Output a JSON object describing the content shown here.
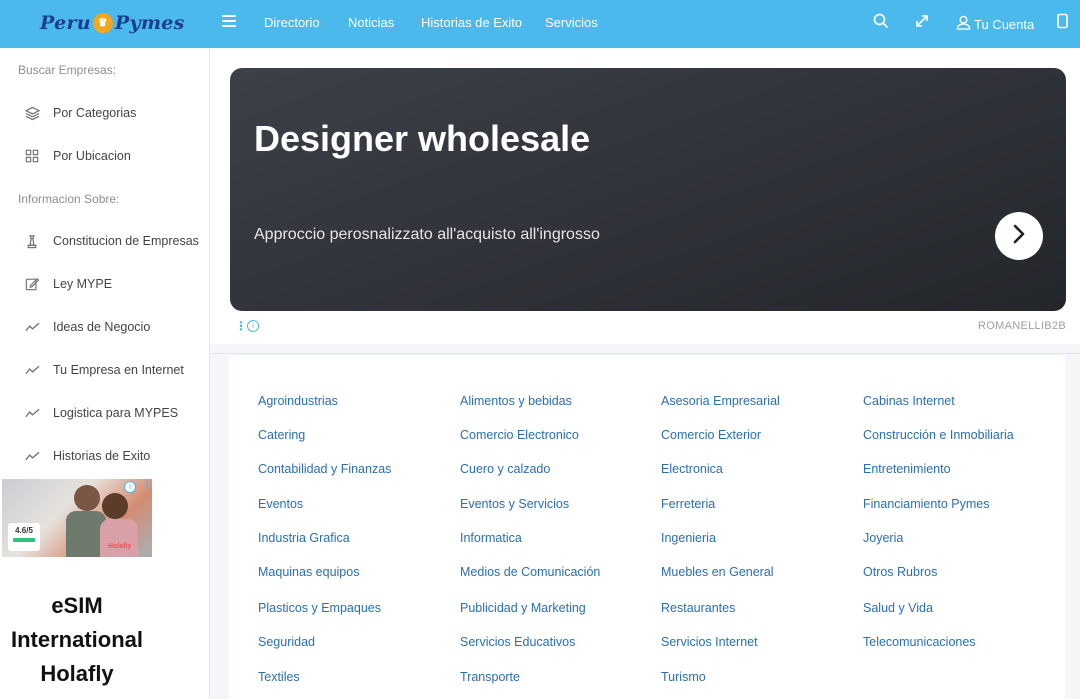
{
  "header": {
    "logo_left": "Peru",
    "logo_right": "Pymes",
    "nav": [
      "Directorio",
      "Noticias",
      "Historias de Exito",
      "Servicios"
    ],
    "account_label": "Tu Cuenta",
    "icons": [
      "menu-icon",
      "search-icon",
      "expand-icon",
      "user-icon",
      "panel-icon"
    ]
  },
  "sidebar": {
    "heading_search": "Buscar Empresas:",
    "search_items": [
      {
        "label": "Por Categorias",
        "icon": "layers-icon"
      },
      {
        "label": "Por Ubicacion",
        "icon": "grid-icon"
      }
    ],
    "heading_info": "Informacion Sobre:",
    "info_items": [
      {
        "label": "Constitucion de Empresas",
        "icon": "chess-icon"
      },
      {
        "label": "Ley MYPE",
        "icon": "edit-icon"
      },
      {
        "label": "Ideas de Negocio",
        "icon": "trend-icon"
      },
      {
        "label": "Tu Empresa en Internet",
        "icon": "trend-icon"
      },
      {
        "label": "Logistica para MYPES",
        "icon": "trend-icon"
      },
      {
        "label": "Historias de Exito",
        "icon": "trend-icon"
      }
    ]
  },
  "side_ad": {
    "rating": "4.6/5",
    "brand_tag": "Holafly",
    "title_lines": [
      "eSIM",
      "International",
      "Holafly"
    ]
  },
  "banner_ad": {
    "title": "Designer wholesale",
    "subtitle": "Approccio perosnalizzato all'acquisto all'ingrosso",
    "advertiser": "ROMANELLIB2B"
  },
  "categories": [
    [
      "Agroindustrias",
      "Alimentos y bebidas",
      "Asesoria Empresarial",
      "Cabinas Internet"
    ],
    [
      "Catering",
      "Comercio Electronico",
      "Comercio Exterior",
      "Construcción e Inmobiliaria"
    ],
    [
      "Contabilidad y Finanzas",
      "Cuero y calzado",
      "Electronica",
      "Entretenimiento"
    ],
    [
      "Eventos",
      "Eventos y Servicios",
      "Ferreteria",
      "Financiamiento Pymes"
    ],
    [
      "Industria Grafica",
      "Informatica",
      "Ingenieria",
      "Joyeria"
    ],
    [
      "Maquinas equipos",
      "Medios de Comunicación",
      "Muebles en General",
      "Otros Rubros"
    ],
    [
      "Plasticos y Empaques",
      "Publicidad y Marketing",
      "Restaurantes",
      "Salud y Vida"
    ],
    [
      "Seguridad",
      "Servicios Educativos",
      "Servicios Internet",
      "Telecomunicaciones"
    ],
    [
      "Textiles",
      "Transporte",
      "Turismo",
      ""
    ]
  ],
  "colors": {
    "header_bg": "#4bb9eb",
    "link": "#2a6fb0",
    "banner_bg": "#2f3238"
  }
}
